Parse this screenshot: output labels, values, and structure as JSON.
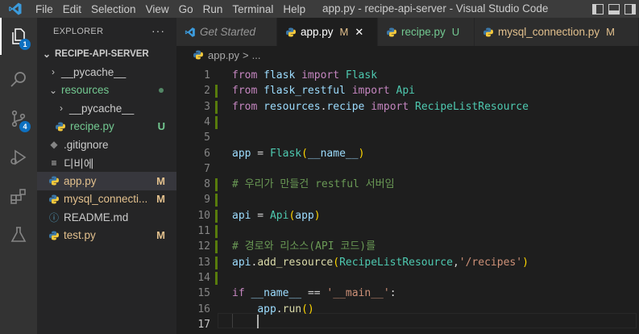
{
  "menu": [
    "File",
    "Edit",
    "Selection",
    "View",
    "Go",
    "Run",
    "Terminal",
    "Help"
  ],
  "window_title": "app.py - recipe-api-server - Visual Studio Code",
  "activity_badges": {
    "explorer": "1",
    "source_control": "4"
  },
  "explorer": {
    "header": "EXPLORER",
    "more": "···",
    "section": "RECIPE-API-SERVER",
    "items": [
      {
        "label": "__pycache__",
        "status": "",
        "color": "#cccccc"
      },
      {
        "label": "resources",
        "status": "",
        "color": "#73c991"
      },
      {
        "label": "__pycache__",
        "status": "",
        "color": "#cccccc"
      },
      {
        "label": "recipe.py",
        "status": "U",
        "color": "#73c991"
      },
      {
        "label": ".gitignore",
        "status": "",
        "color": "#cccccc"
      },
      {
        "label": "디비에",
        "status": "",
        "color": "#cccccc"
      },
      {
        "label": "app.py",
        "status": "M",
        "color": "#e2c08d"
      },
      {
        "label": "mysql_connecti...",
        "status": "M",
        "color": "#e2c08d"
      },
      {
        "label": "README.md",
        "status": "",
        "color": "#cccccc"
      },
      {
        "label": "test.py",
        "status": "M",
        "color": "#e2c08d"
      }
    ]
  },
  "tabs": [
    {
      "label": "Get Started",
      "status": ""
    },
    {
      "label": "app.py",
      "status": "M",
      "close": "✕"
    },
    {
      "label": "recipe.py",
      "status": "U"
    },
    {
      "label": "mysql_connection.py",
      "status": "M"
    }
  ],
  "breadcrumb": {
    "file": "app.py",
    "sep": ">",
    "rest": "..."
  },
  "code_lines": [
    [
      {
        "t": "from",
        "c": "k"
      },
      {
        "t": " flask ",
        "c": "n"
      },
      {
        "t": "import",
        "c": "k"
      },
      {
        "t": " Flask",
        "c": "c"
      }
    ],
    [
      {
        "t": "from",
        "c": "k"
      },
      {
        "t": " flask_restful ",
        "c": "n"
      },
      {
        "t": "import",
        "c": "k"
      },
      {
        "t": " Api",
        "c": "c"
      }
    ],
    [
      {
        "t": "from",
        "c": "k"
      },
      {
        "t": " resources",
        "c": "n"
      },
      {
        "t": ".",
        "c": "p"
      },
      {
        "t": "recipe ",
        "c": "n"
      },
      {
        "t": "import",
        "c": "k"
      },
      {
        "t": " RecipeListResource",
        "c": "c"
      }
    ],
    [],
    [],
    [
      {
        "t": "app",
        "c": "n"
      },
      {
        "t": " = ",
        "c": "p"
      },
      {
        "t": "Flask",
        "c": "c"
      },
      {
        "t": "(",
        "c": "y"
      },
      {
        "t": "__name__",
        "c": "n"
      },
      {
        "t": ")",
        "c": "y"
      }
    ],
    [],
    [
      {
        "t": "# 우리가 만들건 restful 서버임",
        "c": "cm"
      }
    ],
    [],
    [
      {
        "t": "api",
        "c": "n"
      },
      {
        "t": " = ",
        "c": "p"
      },
      {
        "t": "Api",
        "c": "c"
      },
      {
        "t": "(",
        "c": "y"
      },
      {
        "t": "app",
        "c": "n"
      },
      {
        "t": ")",
        "c": "y"
      }
    ],
    [],
    [
      {
        "t": "# 경로와 리소스(API 코드)를",
        "c": "cm"
      }
    ],
    [
      {
        "t": "api",
        "c": "n"
      },
      {
        "t": ".",
        "c": "p"
      },
      {
        "t": "add_resource",
        "c": "f"
      },
      {
        "t": "(",
        "c": "y"
      },
      {
        "t": "RecipeListResource",
        "c": "c"
      },
      {
        "t": ",",
        "c": "p"
      },
      {
        "t": "'/recipes'",
        "c": "s"
      },
      {
        "t": ")",
        "c": "y"
      }
    ],
    [],
    [
      {
        "t": "if",
        "c": "k"
      },
      {
        "t": " __name__ ",
        "c": "n"
      },
      {
        "t": "==",
        "c": "p"
      },
      {
        "t": " '__main__'",
        "c": "s"
      },
      {
        "t": ":",
        "c": "p"
      }
    ],
    [
      {
        "t": "    ",
        "c": "p"
      },
      {
        "t": "app",
        "c": "n"
      },
      {
        "t": ".",
        "c": "p"
      },
      {
        "t": "run",
        "c": "f"
      },
      {
        "t": "()",
        "c": "y"
      }
    ],
    []
  ],
  "line_numbers": [
    "1",
    "2",
    "3",
    "4",
    "5",
    "6",
    "7",
    "8",
    "9",
    "10",
    "11",
    "12",
    "13",
    "14",
    "15",
    "16",
    "17"
  ],
  "gutter_marks": [
    "",
    "added",
    "added",
    "added",
    "",
    "",
    "",
    "added",
    "added",
    "added",
    "added",
    "added",
    "added",
    "added",
    "",
    "",
    ""
  ],
  "colors": {
    "accent": "#0e70c0",
    "added": "#587c0c",
    "modified": "#e2c08d",
    "untracked": "#73c991"
  }
}
